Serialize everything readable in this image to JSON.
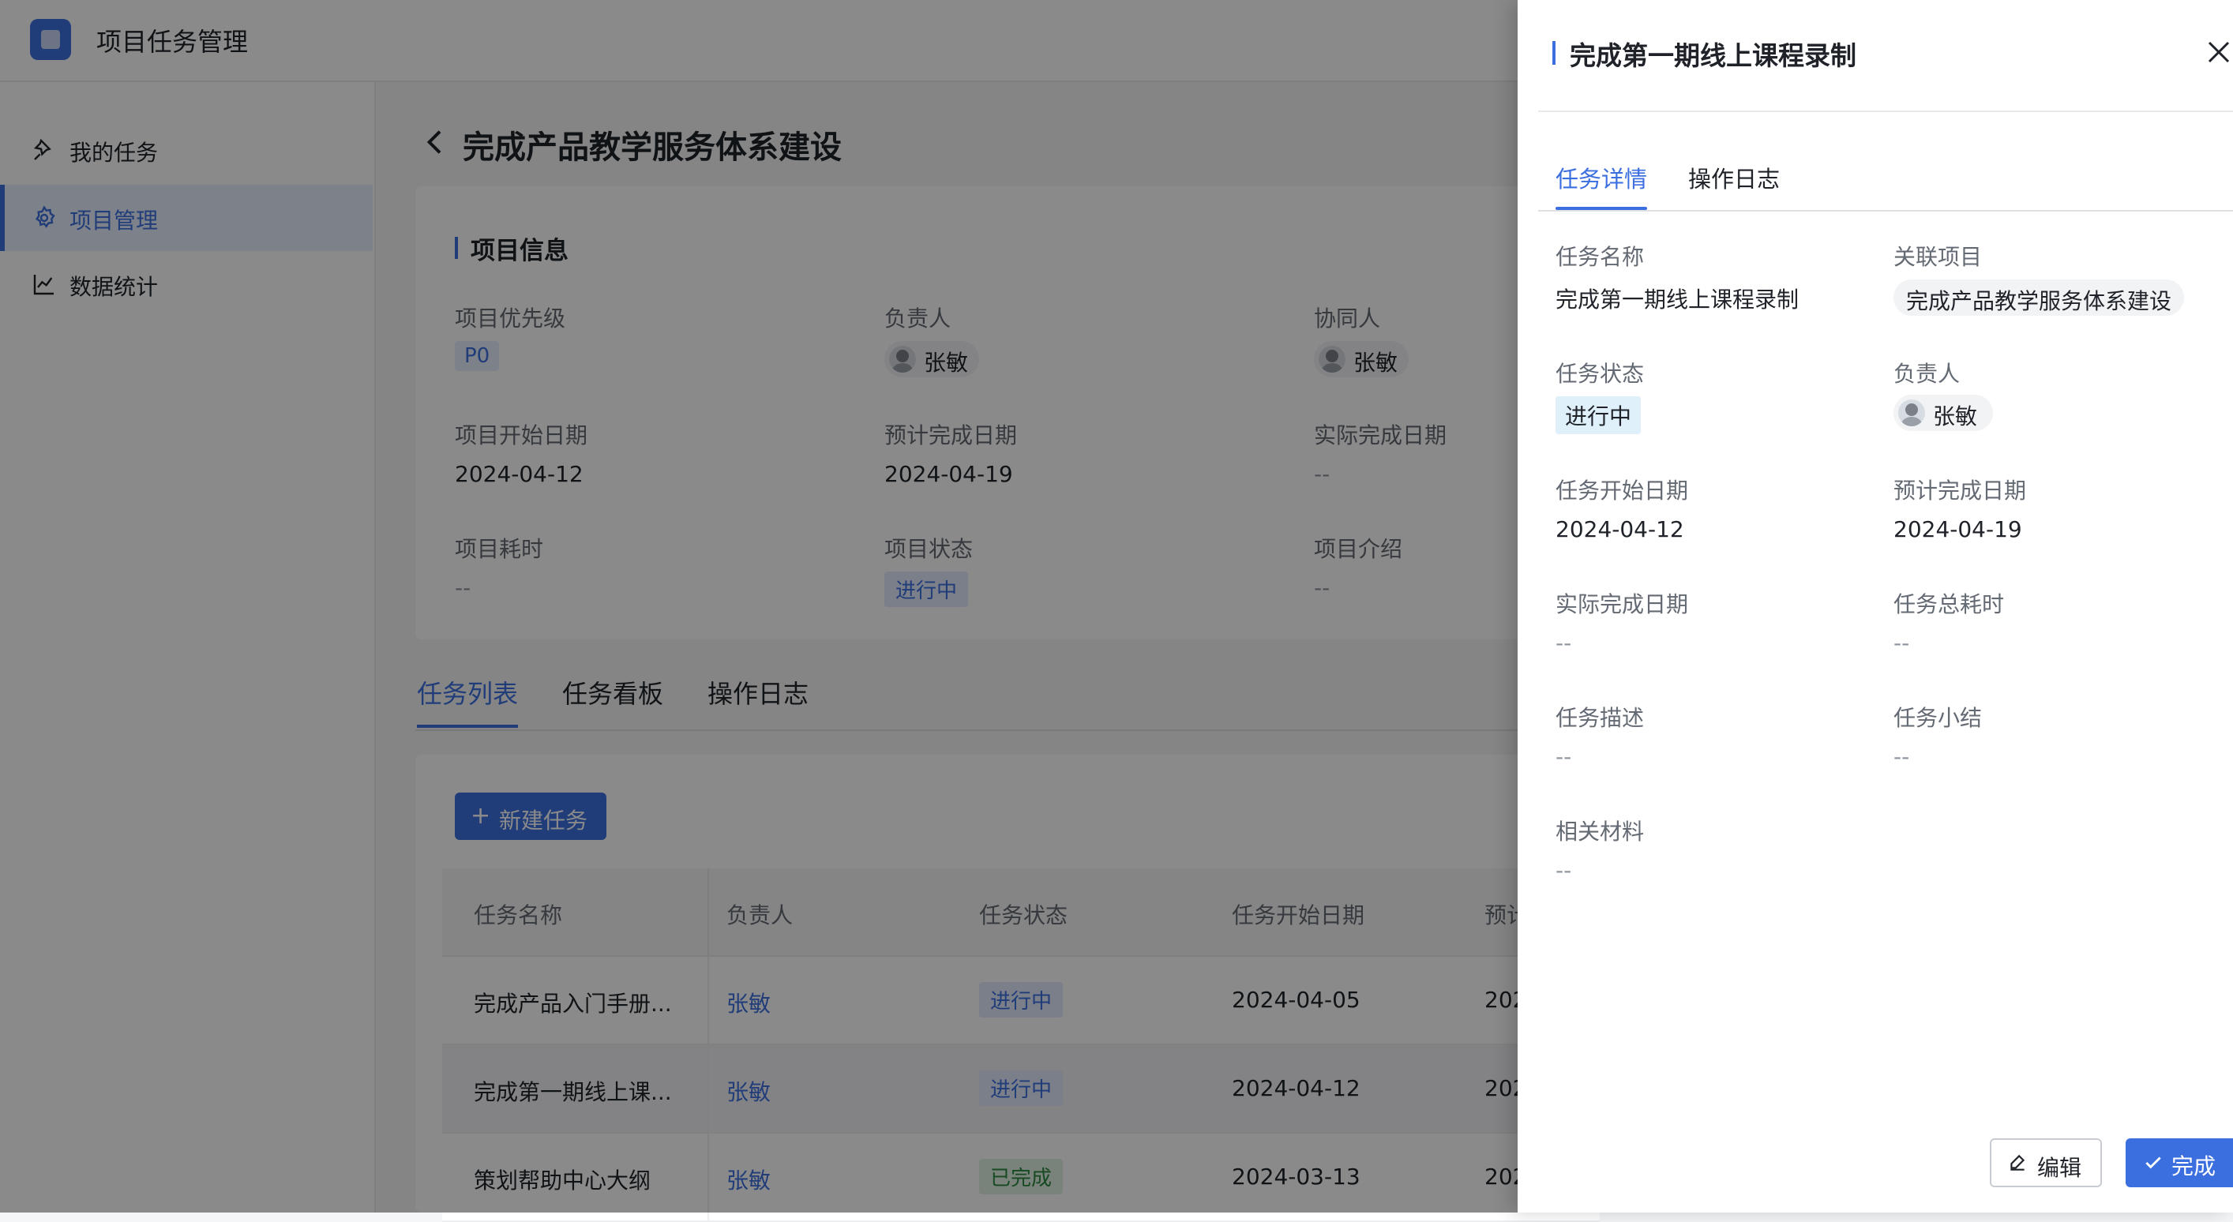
{
  "app": {
    "title": "项目任务管理"
  },
  "sidebar": {
    "items": [
      {
        "label": "我的任务",
        "icon": "pin-icon",
        "active": false
      },
      {
        "label": "项目管理",
        "icon": "gear-icon",
        "active": true
      },
      {
        "label": "数据统计",
        "icon": "chart-icon",
        "active": false
      }
    ]
  },
  "page": {
    "title": "完成产品教学服务体系建设"
  },
  "project_info": {
    "section_title": "项目信息",
    "priority_label": "项目优先级",
    "priority_value": "P0",
    "owner_label": "负责人",
    "owner_value": "张敏",
    "collaborator_label": "协同人",
    "collaborator_value": "张敏",
    "start_label": "项目开始日期",
    "start_value": "2024-04-12",
    "planned_end_label": "预计完成日期",
    "planned_end_value": "2024-04-19",
    "actual_end_label": "实际完成日期",
    "actual_end_value": "--",
    "duration_label": "项目耗时",
    "duration_value": "--",
    "status_label": "项目状态",
    "status_value": "进行中",
    "intro_label": "项目介绍",
    "intro_value": "--"
  },
  "tabs": [
    {
      "label": "任务列表",
      "active": true
    },
    {
      "label": "任务看板",
      "active": false
    },
    {
      "label": "操作日志",
      "active": false
    }
  ],
  "task_list": {
    "new_button": "新建任务",
    "headers": [
      "任务名称",
      "负责人",
      "任务状态",
      "任务开始日期",
      "预计"
    ],
    "rows": [
      {
        "name": "完成产品入门手册...",
        "owner": "张敏",
        "status": "进行中",
        "start": "2024-04-05",
        "end": "202"
      },
      {
        "name": "完成第一期线上课...",
        "owner": "张敏",
        "status": "进行中",
        "start": "2024-04-12",
        "end": "202"
      },
      {
        "name": "策划帮助中心大纲",
        "owner": "张敏",
        "status": "已完成",
        "start": "2024-03-13",
        "end": "202"
      }
    ]
  },
  "drawer": {
    "title": "完成第一期线上课程录制",
    "tabs": [
      {
        "label": "任务详情",
        "active": true
      },
      {
        "label": "操作日志",
        "active": false
      }
    ],
    "fields": {
      "name_label": "任务名称",
      "name_value": "完成第一期线上课程录制",
      "project_label": "关联项目",
      "project_value": "完成产品教学服务体系建设",
      "status_label": "任务状态",
      "status_value": "进行中",
      "owner_label": "负责人",
      "owner_value": "张敏",
      "start_label": "任务开始日期",
      "start_value": "2024-04-12",
      "planned_end_label": "预计完成日期",
      "planned_end_value": "2024-04-19",
      "actual_end_label": "实际完成日期",
      "actual_end_value": "--",
      "duration_label": "任务总耗时",
      "duration_value": "--",
      "desc_label": "任务描述",
      "desc_value": "--",
      "summary_label": "任务小结",
      "summary_value": "--",
      "materials_label": "相关材料",
      "materials_value": "--"
    },
    "edit_button": "编辑",
    "done_button": "完成"
  },
  "colors": {
    "accent": "#3b6fe0",
    "overlay": "#000000"
  }
}
